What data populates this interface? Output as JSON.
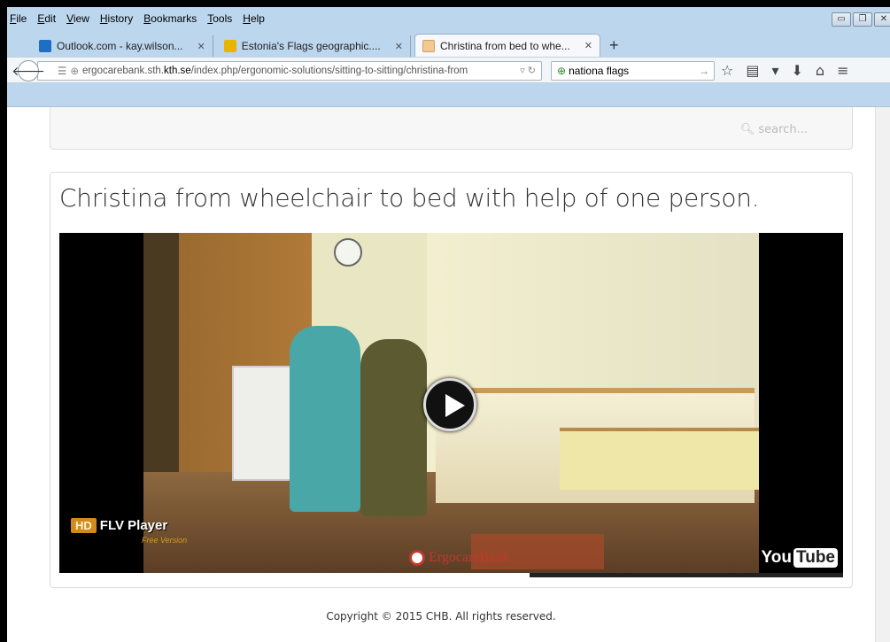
{
  "menu": [
    "File",
    "Edit",
    "View",
    "History",
    "Bookmarks",
    "Tools",
    "Help"
  ],
  "tabs": [
    {
      "title": "Outlook.com - kay.wilson...",
      "fav_color": "#1e6fc4"
    },
    {
      "title": "Estonia's Flags geographic....",
      "fav_color": "#e8b400"
    },
    {
      "title": "Christina from bed to whe...",
      "fav_color": "#f4c891",
      "active": true
    }
  ],
  "newtab_label": "+",
  "url": {
    "prefix": "ergocarebank.sth.",
    "domain": "kth.se",
    "path": "/index.php/ergonomic-solutions/sitting-to-sitting/christina-from"
  },
  "search_box": {
    "value": "nationa flags"
  },
  "site_search": {
    "placeholder": "search..."
  },
  "article": {
    "title": "Christina from wheelchair to bed with help of one person."
  },
  "video": {
    "hd_badge": "HD",
    "player_name": "FLV Player",
    "free_version": "Free Version",
    "watermark": "ErgocareBank",
    "yt_you": "You",
    "yt_tube": "Tube",
    "progress_fraction": 0.6
  },
  "footer": {
    "copyright": "Copyright © 2015 CHB. All rights reserved."
  }
}
